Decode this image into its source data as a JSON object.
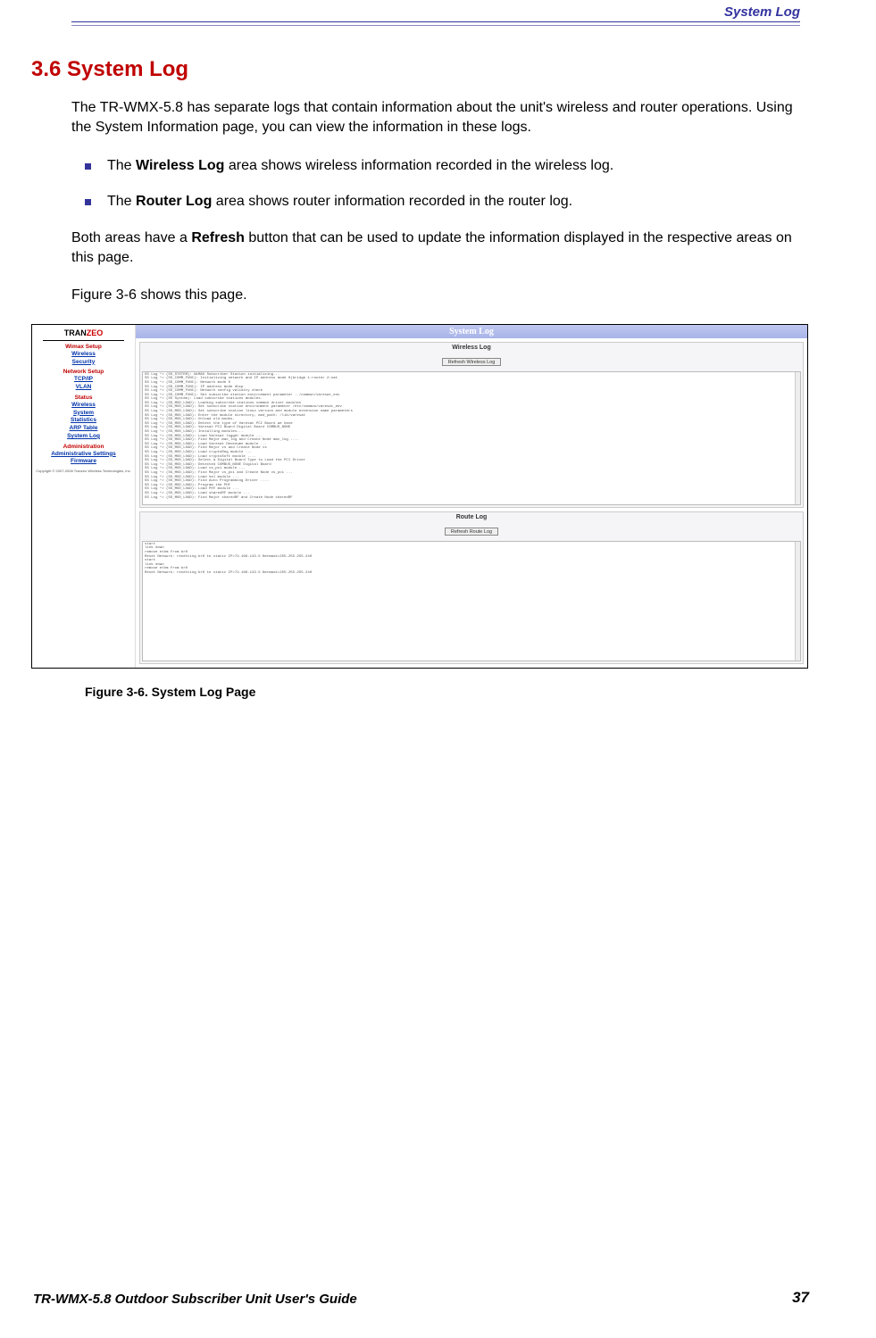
{
  "header": {
    "label": "System Log"
  },
  "section": {
    "heading": "3.6 System Log",
    "intro": "The TR-WMX-5.8 has separate logs that contain information about the unit's wireless and router operations. Using the System Information page, you can view the information in these logs.",
    "bullet1_pre": "The ",
    "bullet1_bold": "Wireless Log",
    "bullet1_post": " area shows wireless information recorded in the wireless log.",
    "bullet2_pre": "The ",
    "bullet2_bold": "Router Log",
    "bullet2_post": " area shows router information recorded in the router log.",
    "para2_pre": "Both areas have a ",
    "para2_bold": "Refresh",
    "para2_post": " button that can be used to update the information displayed in the respective areas on this page.",
    "para3": "Figure 3-6 shows this page."
  },
  "screenshot": {
    "logo_tran": "TRAN",
    "logo_zeo": "ZEO",
    "sidebar": {
      "wimax": "Wimax Setup",
      "wimax_items": [
        "Wireless",
        "Security"
      ],
      "network": "Network Setup",
      "network_items": [
        "TCP/IP",
        "VLAN"
      ],
      "status": "Status",
      "status_items": [
        "Wireless",
        "System",
        "Statistics",
        "ARP Table",
        "System Log"
      ],
      "admin": "Administration",
      "admin_items": [
        "Administrative Settings",
        "Firmware"
      ],
      "copyright": "Copyright © 2007-2008 Tranzeo Wireless Technologies, Inc."
    },
    "main_title": "System Log",
    "wireless_log_title": "Wireless Log",
    "refresh_wireless": "Refresh Wireless Log",
    "wireless_log_content": "SS Log *> (SS_SYSTEM): WiMAX Subscriber Station initializing...\nSS Log *> (SS_COMM_FUNC): Initializing network and IP address mode 0(bridge 1:router 2:nat\nSS Log *> (SS_COMM_FUNC): Network mode 0\nSS Log *> (SS_COMM_FUNC): IP address mode dhcp\nSS Log *> (SS_COMM_FUNC): Network config validity check\nSS Log *> (SS_COMM_FUNC): Set subscribe station environment parameter ../common/varesat_env\nSS Log *> (SS System): Load subscribe stations modules.\nSS Log *> (SS_MOD_LOAD): Loading subscribe stations common driver modules\nSS Log *> (SS_MOD_LOAD): Set subscribe station environment parameter /etc/common/varesat_env\nSS Log *> (SS_MOD_LOAD): Set subscribe station linux version and module extension name parameters\nSS Log *> (SS_MOD_LOAD): Enter the module directory, mod_path: /lib/varesat\nSS Log *> (SS_MOD_LOAD): Unload old modes.\nSS Log *> (SS_MOD_LOAD): Detect the type of Varesat PCI Board we have\nSS Log *> (SS_MOD_LOAD): Varesat PCI Board Digital Board COMBUS_NONE\nSS Log *> (SS_MOD_LOAD): Installing modules...\nSS Log *> (SS_MOD_LOAD): Load Varesat logger module ...\nSS Log *> (SS_MOD_LOAD): Find Major mac_log and Create Node mac_log ....\nSS Log *> (SS_MOD_LOAD): Load Varesat Devenumn module ...\nSS Log *> (SS_MOD_LOAD): Find Major vs and Create Node vs\nSS Log *> (SS_MOD_LOAD): Load cryptoReg module ...\nSS Log *> (SS_MOD_LOAD): Load cryptoSoft module ....\nSS Log *> (SS_MOD_LOAD): Select a Digital Board Type to Load the PCI Driver\nSS Log *> (SS_MOD_LOAD): Detected COMBUS_NONE Digital Board\nSS Log *> (SS_MOD_LOAD): Load vs_pci module ...\nSS Log *> (SS_MOD_LOAD): Find Major vs_pci and Create Node vs_pci ...\nSS Log *> (SS_MOD_LOAD): Load hal module ...\nSS Log *> (SS_MOD_LOAD): Find Auto Programming Driver ....\nSS Log *> (SS_MOD_LOAD): Program the PHY\nSS Log *> (SS_MOD_LOAD): Load PHY module ...\nSS Log *> (SS_MOD_LOAD): Load sharedRF module ...\nSS Log *> (SS_MOD_LOAD): Find Major sharedRF and Create Node sharedRF",
    "route_log_title": "Route Log",
    "refresh_route": "Refresh Route Log",
    "route_log_content": "start\nlink down\nremove ethm from br0\nReset Network: resetting br0 to static IP=72.166.143.5 Netmask=255.255.255.240\nstart\nlink down\nremove ethm from br0\nReset Network: resetting br0 to static IP=72.166.143.5 Netmask=255.255.255.240"
  },
  "caption": "Figure 3-6. System Log Page",
  "footer": {
    "guide": "TR-WMX-5.8 Outdoor Subscriber Unit User's Guide",
    "page": "37"
  }
}
